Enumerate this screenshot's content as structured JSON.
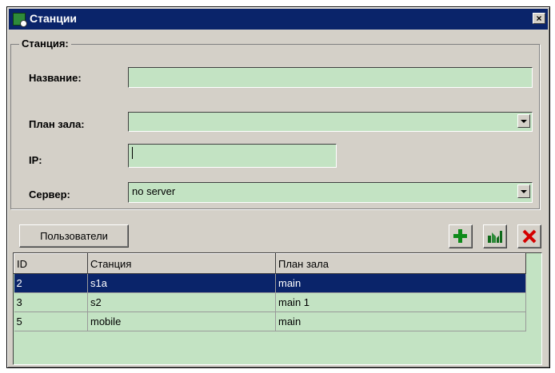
{
  "window": {
    "title": "Станции",
    "close_symbol": "×"
  },
  "station": {
    "group_label": "Станция:",
    "name_label": "Название:",
    "name_value": "",
    "hall_plan_label": "План зала:",
    "hall_plan_value": "",
    "ip_label": "IP:",
    "ip_value": "",
    "server_label": "Сервер:",
    "server_value": "no server"
  },
  "toolbar": {
    "users_button": "Пользователи",
    "add_icon": "plus-icon",
    "edit_icon": "edit-icon",
    "delete_icon": "delete-x-icon"
  },
  "table": {
    "columns": [
      "ID",
      "Станция",
      "План зала"
    ],
    "rows": [
      {
        "id": "2",
        "station": "s1a",
        "plan": "main",
        "selected": true
      },
      {
        "id": "3",
        "station": "s2",
        "plan": "main 1",
        "selected": false
      },
      {
        "id": "5",
        "station": "mobile",
        "plan": "main",
        "selected": false
      }
    ]
  },
  "colors": {
    "field_bg": "#c3e3c3",
    "title_bg": "#0a246a",
    "selection_bg": "#0a246a",
    "add_green": "#0f8a1a",
    "delete_red": "#d40000"
  }
}
